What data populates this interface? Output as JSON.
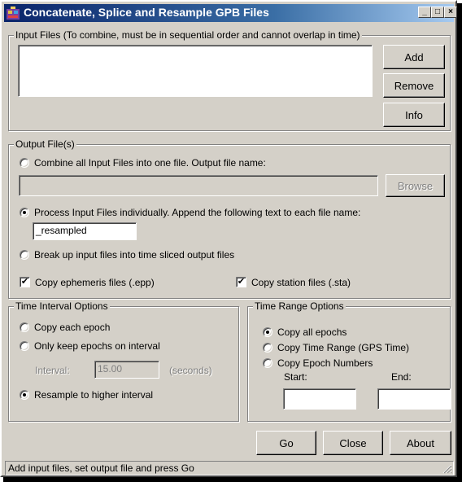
{
  "window": {
    "title": "Concatenate, Splice and Resample GPB Files",
    "minimize_label": "_",
    "maximize_label": "□",
    "close_label": "×"
  },
  "input_files": {
    "legend": "Input Files (To combine, must be in sequential order and cannot overlap in time)",
    "add_label": "Add",
    "remove_label": "Remove",
    "info_label": "Info",
    "files": []
  },
  "output": {
    "legend": "Output File(s)",
    "combine_label": "Combine all Input Files into one file. Output file name:",
    "combine_selected": false,
    "combine_filename": "",
    "browse_label": "Browse",
    "individual_label": "Process Input Files individually. Append the following text to each file name:",
    "individual_selected": true,
    "append_text": "_resampled",
    "slice_label": "Break up input files into time sliced output files",
    "slice_selected": false,
    "copy_epp_label": "Copy ephemeris files (.epp)",
    "copy_epp_checked": true,
    "copy_sta_label": "Copy station files (.sta)",
    "copy_sta_checked": true
  },
  "time_interval": {
    "legend": "Time Interval Options",
    "copy_each_label": "Copy each epoch",
    "copy_each_selected": false,
    "only_keep_label": "Only keep epochs on interval",
    "only_keep_selected": false,
    "interval_label": "Interval:",
    "interval_value": "15.00",
    "seconds_label": "(seconds)",
    "resample_label": "Resample to higher interval",
    "resample_selected": true
  },
  "time_range": {
    "legend": "Time Range Options",
    "copy_all_label": "Copy all epochs",
    "copy_all_selected": true,
    "copy_range_label": "Copy Time Range (GPS Time)",
    "copy_range_selected": false,
    "copy_numbers_label": "Copy Epoch Numbers",
    "copy_numbers_selected": false,
    "start_label": "Start:",
    "start_value": "",
    "end_label": "End:",
    "end_value": ""
  },
  "actions": {
    "go_label": "Go",
    "close_label": "Close",
    "about_label": "About"
  },
  "status": {
    "text": "Add input files, set output file and press Go"
  }
}
